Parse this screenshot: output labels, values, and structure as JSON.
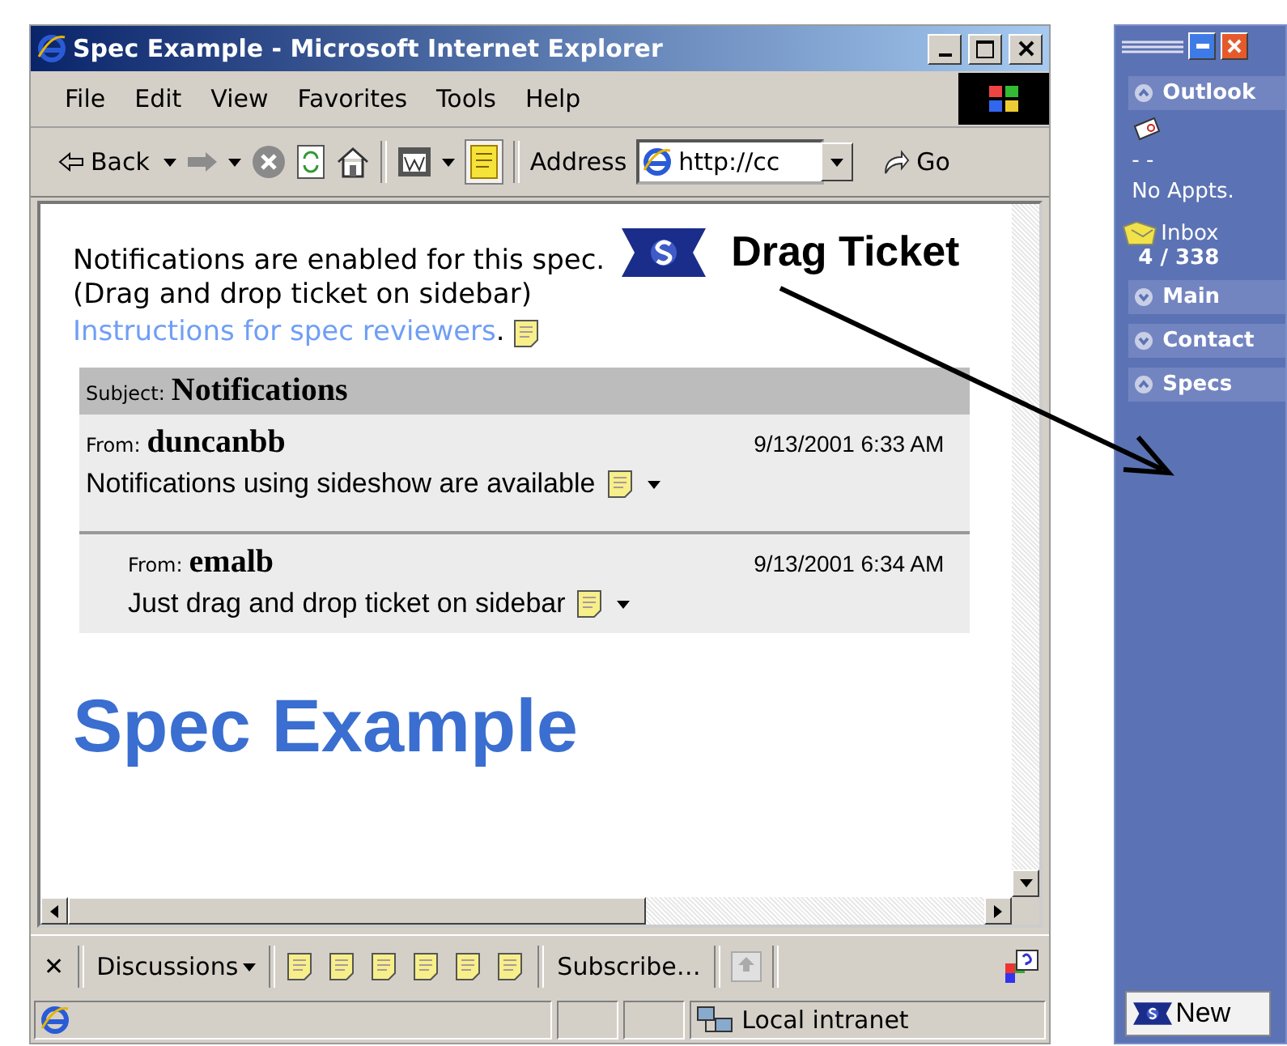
{
  "window": {
    "title": "Spec Example - Microsoft Internet Explorer"
  },
  "menu": [
    "File",
    "Edit",
    "View",
    "Favorites",
    "Tools",
    "Help"
  ],
  "toolbar": {
    "back": "Back",
    "address_label": "Address",
    "url": "http://cc",
    "go": "Go",
    "notes_selected": true
  },
  "page": {
    "notice": "Notifications are enabled for this spec.",
    "drag_label": "Drag Ticket",
    "hint": "(Drag and drop ticket on sidebar)",
    "link": "Instructions for spec reviewers",
    "link_end": ".",
    "thread": {
      "subject_label": "Subject:",
      "subject": "Notifications",
      "posts": [
        {
          "from_label": "From:",
          "author": "duncanbb",
          "time": "9/13/2001 6:33 AM",
          "body": "Notifications using sideshow are available",
          "children": [
            {
              "from_label": "From:",
              "author": "emalb",
              "time": "9/13/2001 6:34 AM",
              "body": "Just drag and drop ticket on sidebar"
            }
          ]
        }
      ]
    },
    "heading": "Spec Example"
  },
  "discussions": {
    "close": "✕",
    "label": "Discussions",
    "subscribe": "Subscribe…"
  },
  "status_bar": {
    "zone": "Local intranet"
  },
  "sidebar": {
    "sections": [
      {
        "title": "Outlook",
        "expanded": true,
        "dash": "- -",
        "appts": "No Appts.",
        "inbox": "Inbox",
        "count": "4 / 338"
      },
      {
        "title": "Main",
        "expanded": false
      },
      {
        "title": "Contact",
        "expanded": false
      },
      {
        "title": "Specs",
        "expanded": true
      }
    ],
    "new_button": "New"
  }
}
